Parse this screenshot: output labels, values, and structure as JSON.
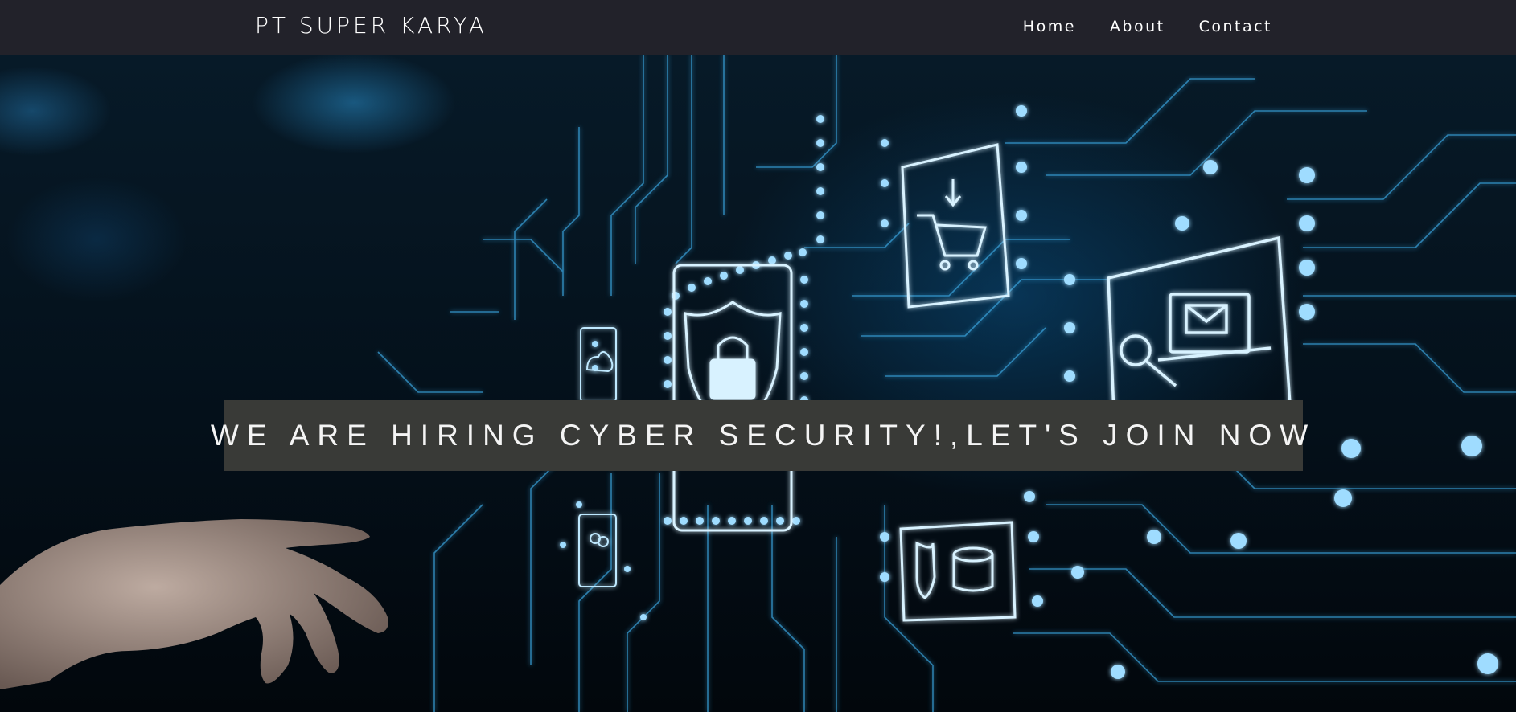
{
  "navbar": {
    "brand": "PT SUPER KARYA",
    "links": [
      {
        "label": "Home"
      },
      {
        "label": "About"
      },
      {
        "label": "Contact"
      }
    ]
  },
  "hero": {
    "banner_text": "WE ARE HIRING CYBER SECURITY!,LET'S JOIN NOW",
    "image_description_icons": [
      "shopping-cart-icon",
      "shield-lock-icon",
      "cloud-lock-icon",
      "email-laptop-icon",
      "magnifier-lock-icon",
      "users-icon",
      "shield-database-icon"
    ]
  },
  "colors": {
    "navbar_bg": "#22222a",
    "banner_bg": "#393a37",
    "circuit_glow": "#7fd2ff"
  }
}
